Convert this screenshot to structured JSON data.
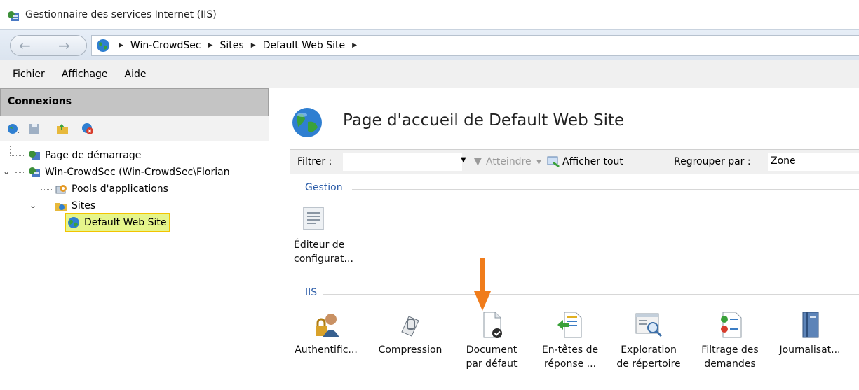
{
  "window": {
    "title": "Gestionnaire des services Internet (IIS)",
    "icon": "iis-manager-icon"
  },
  "address": {
    "crumbs": [
      "Win-CrowdSec",
      "Sites",
      "Default Web Site"
    ],
    "back_icon": "back-arrow-icon",
    "forward_icon": "forward-arrow-icon"
  },
  "menu": {
    "items": [
      "Fichier",
      "Affichage",
      "Aide"
    ]
  },
  "connections": {
    "header": "Connexions",
    "tree": {
      "start_page": "Page de démarrage",
      "server": "Win-CrowdSec (Win-CrowdSec\\Florian",
      "app_pools": "Pools d'applications",
      "sites": "Sites",
      "default_site": "Default Web Site"
    },
    "selection_color": "#e5f58b"
  },
  "home": {
    "title": "Page d'accueil de Default Web Site",
    "filter": {
      "label": "Filtrer :",
      "value": "",
      "go_label": "Atteindre",
      "show_all_label": "Afficher tout",
      "group_label": "Regrouper par :",
      "group_value": "Zone"
    },
    "sections": {
      "management": {
        "label": "Gestion",
        "items": [
          "Éditeur de\nconfigurat..."
        ]
      },
      "iis": {
        "label": "IIS",
        "items": [
          "Authentific...",
          "Compression",
          "Document\npar défaut",
          "En-têtes de\nréponse ...",
          "Exploration\nde répertoire",
          "Filtrage des\ndemandes",
          "Journalisat..."
        ]
      }
    }
  },
  "annotation": {
    "arrow_color": "#f07c1b",
    "target": "Document par défaut"
  }
}
